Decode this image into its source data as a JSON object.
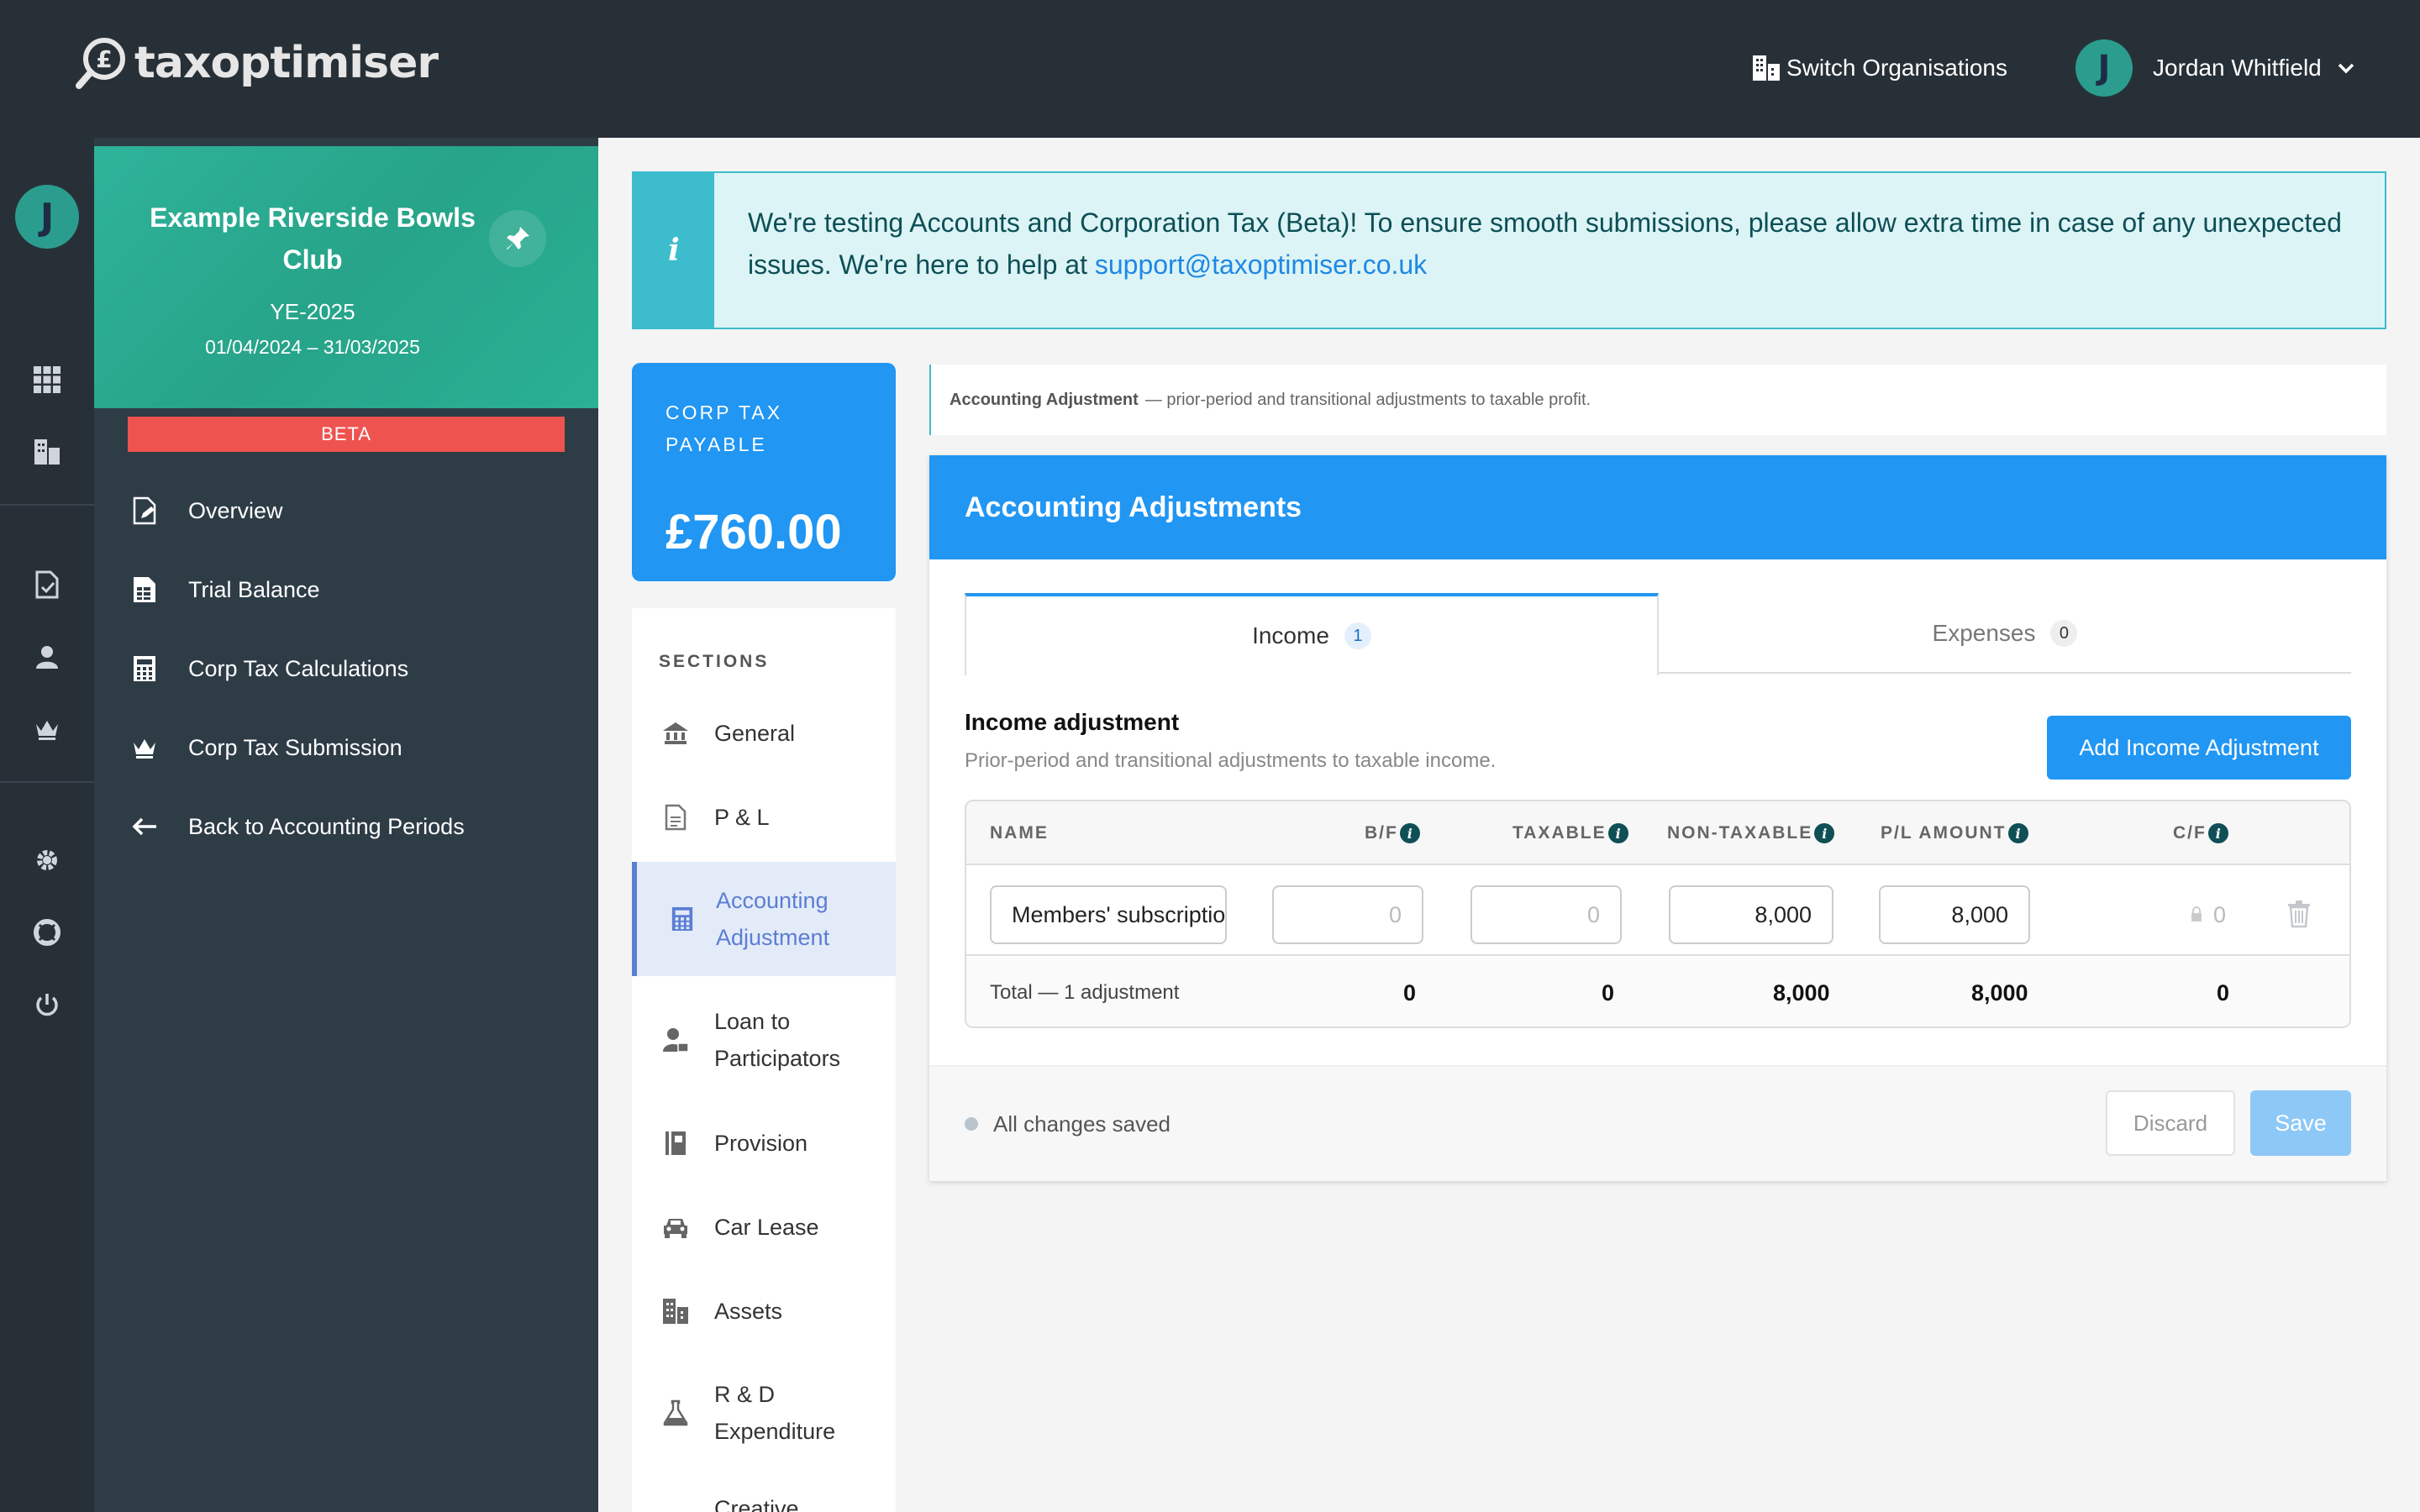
{
  "app": {
    "logo_text": "taxoptimiser"
  },
  "header": {
    "switch_label": "Switch Organisations",
    "user_initial": "J",
    "user_name": "Jordan Whitfield"
  },
  "rail": {
    "avatar_initial": "J"
  },
  "org": {
    "name": "Example Riverside Bowls Club",
    "ye": "YE-2025",
    "dates": "01/04/2024 – 31/03/2025",
    "badge": "BETA"
  },
  "nav": {
    "items": [
      {
        "label": "Overview"
      },
      {
        "label": "Trial Balance"
      },
      {
        "label": "Corp Tax Calculations"
      },
      {
        "label": "Corp Tax Submission"
      },
      {
        "label": "Back to Accounting Periods"
      }
    ]
  },
  "banner": {
    "text": "We're testing Accounts and Corporation Tax (Beta)! To ensure smooth submissions, please allow extra time in case of any unexpected issues. We're here to help at ",
    "email": "support@taxoptimiser.co.uk"
  },
  "corp_tax": {
    "label": "CORP TAX PAYABLE",
    "value": "£760.00"
  },
  "sections": {
    "title": "SECTIONS",
    "items": [
      {
        "label": "General"
      },
      {
        "label": "P & L"
      },
      {
        "label": "Accounting Adjustment"
      },
      {
        "label": "Loan to Participators"
      },
      {
        "label": "Provision"
      },
      {
        "label": "Car Lease"
      },
      {
        "label": "Assets"
      },
      {
        "label": "R & D Expenditure"
      },
      {
        "label": "Creative"
      }
    ]
  },
  "crumb": {
    "title": "Accounting Adjustment",
    "desc": "— prior-period and transitional adjustments to taxable profit."
  },
  "panel": {
    "title": "Accounting Adjustments",
    "tabs": [
      {
        "label": "Income",
        "count": "1"
      },
      {
        "label": "Expenses",
        "count": "0"
      }
    ],
    "sub_title": "Income adjustment",
    "sub_desc": "Prior-period and transitional adjustments to taxable income.",
    "add_button": "Add Income Adjustment",
    "columns": {
      "name": "NAME",
      "bf": "B/F",
      "taxable": "TAXABLE",
      "non_taxable": "NON-TAXABLE",
      "pl_amount": "P/L AMOUNT",
      "cf": "C/F",
      "info_glyph": "i"
    },
    "row": {
      "name": "Members' subscriptions",
      "bf": "0",
      "taxable": "0",
      "non_taxable": "8,000",
      "pl_amount": "8,000",
      "cf": "0"
    },
    "total": {
      "label": "Total — 1 adjustment",
      "bf": "0",
      "taxable": "0",
      "non_taxable": "8,000",
      "pl_amount": "8,000",
      "cf": "0"
    },
    "status": "All changes saved",
    "discard": "Discard",
    "save": "Save"
  }
}
